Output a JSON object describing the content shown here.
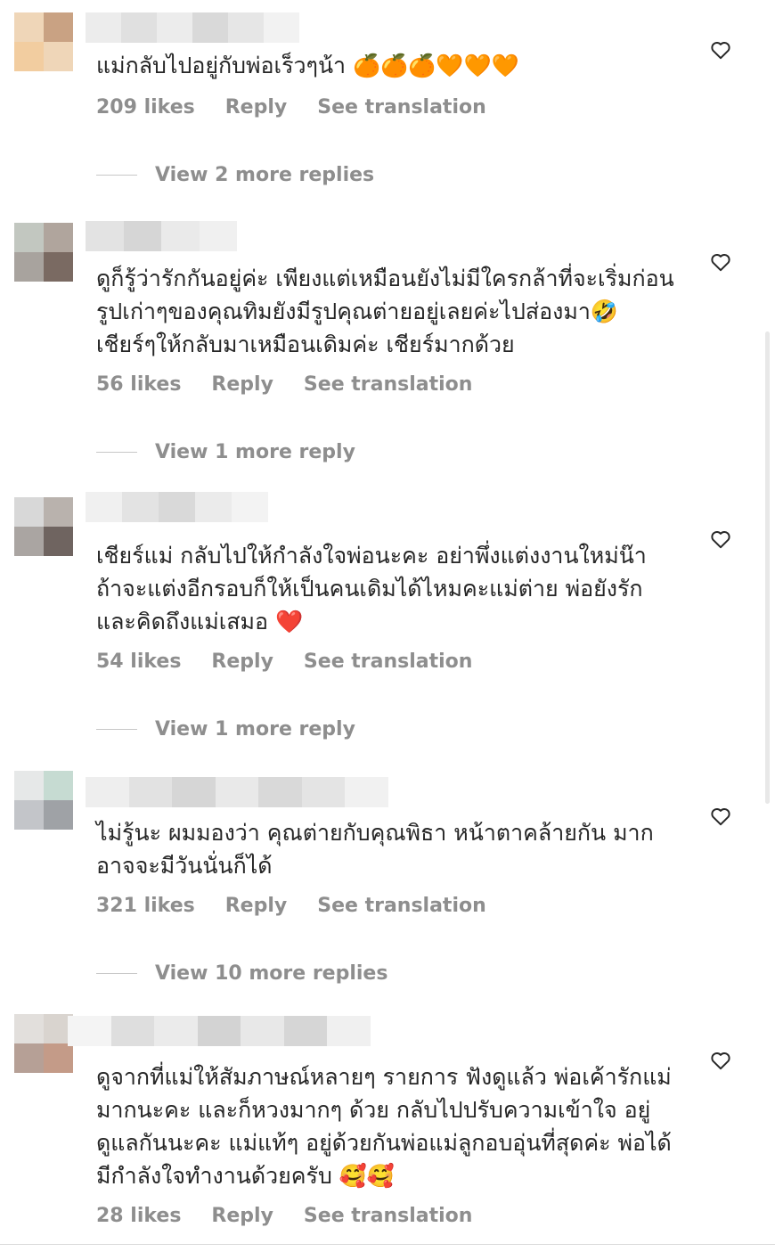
{
  "comments": [
    {
      "text": "แม่กลับไปอยู่กับพ่อเร็วๆน้า 🍊🍊🍊🧡🧡🧡",
      "likes": "209 likes",
      "reply": "Reply",
      "see_translation": "See translation",
      "view_replies": "View 2 more replies"
    },
    {
      "text": "ดูก็รู้ว่ารักกันอยู่ค่ะ เพียงแต่เหมือนยังไม่มีใครกล้าที่จะเริ่มก่อน รูปเก่าๆของคุณทิมยังมีรูปคุณต่ายอยู่เลยค่ะไปส่องมา🤣เชียร์ๆให้กลับมาเหมือนเดิมค่ะ เชียร์มากด้วย",
      "likes": "56 likes",
      "reply": "Reply",
      "see_translation": "See translation",
      "view_replies": "View 1 more reply"
    },
    {
      "text": "เชียร์แม่ กลับไปให้กำลังใจพ่อนะคะ อย่าพึ่งแต่งงานใหม่น๊า ถ้าจะแต่งอีกรอบก็ให้เป็นคนเดิมได้ไหมคะแม่ต่าย พ่อยังรักและคิดถึงแม่เสมอ ❤️",
      "likes": "54 likes",
      "reply": "Reply",
      "see_translation": "See translation",
      "view_replies": "View 1 more reply"
    },
    {
      "text": "ไม่รู้นะ ผมมองว่า คุณต่ายกับคุณพิธา หน้าตาคล้ายกัน มาก อาจจะมีวันนั่นก็ได้",
      "likes": "321 likes",
      "reply": "Reply",
      "see_translation": "See translation",
      "view_replies": "View 10 more replies"
    },
    {
      "text": "ดูจากที่แม่ให้สัมภาษณ์หลายๆ รายการ ฟังดูแล้ว พ่อเค้ารักแม่มากนะคะ และก็หวงมากๆ ด้วย กลับไปปรับความเข้าใจ อยู่ดูแลกันนะคะ แม่แท้ๆ อยู่ด้วยกันพ่อแม่ลูกอบอุ่นที่สุดค่ะ พ่อได้มีกำลังใจทำงานด้วยครับ 🥰🥰",
      "likes": "28 likes",
      "reply": "Reply",
      "see_translation": "See translation"
    }
  ],
  "colors": {
    "text": "#262626",
    "secondary": "#8e8e8e"
  },
  "icons": {
    "like": "heart-outline-icon"
  }
}
